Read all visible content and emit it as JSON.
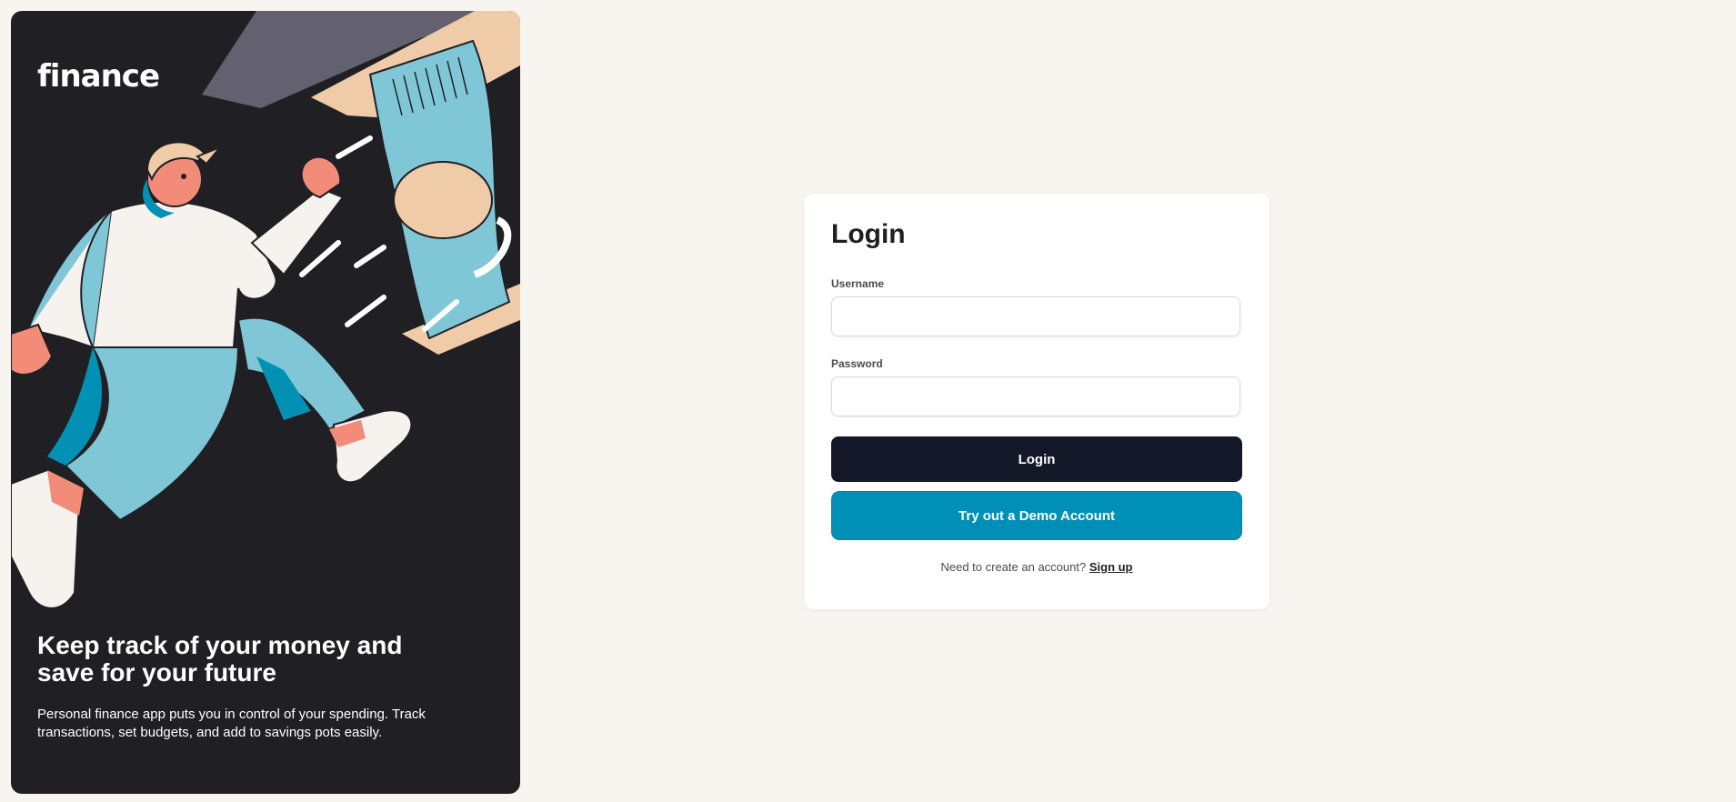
{
  "brand": {
    "logo": "finance"
  },
  "hero": {
    "title": "Keep track of your money and save for your future",
    "description": "Personal finance app puts you in control of your spending. Track transactions, set budgets, and add to savings pots easily."
  },
  "login_form": {
    "title": "Login",
    "username_label": "Username",
    "username_value": "",
    "password_label": "Password",
    "password_value": "",
    "login_button": "Login",
    "demo_button": "Try out a Demo Account",
    "signup_prompt": "Need to create an account?",
    "signup_link": "Sign up"
  },
  "colors": {
    "page_background": "#F8F4F0",
    "hero_background": "#201F24",
    "primary_button": "#121828",
    "demo_button": "#0090B7"
  }
}
